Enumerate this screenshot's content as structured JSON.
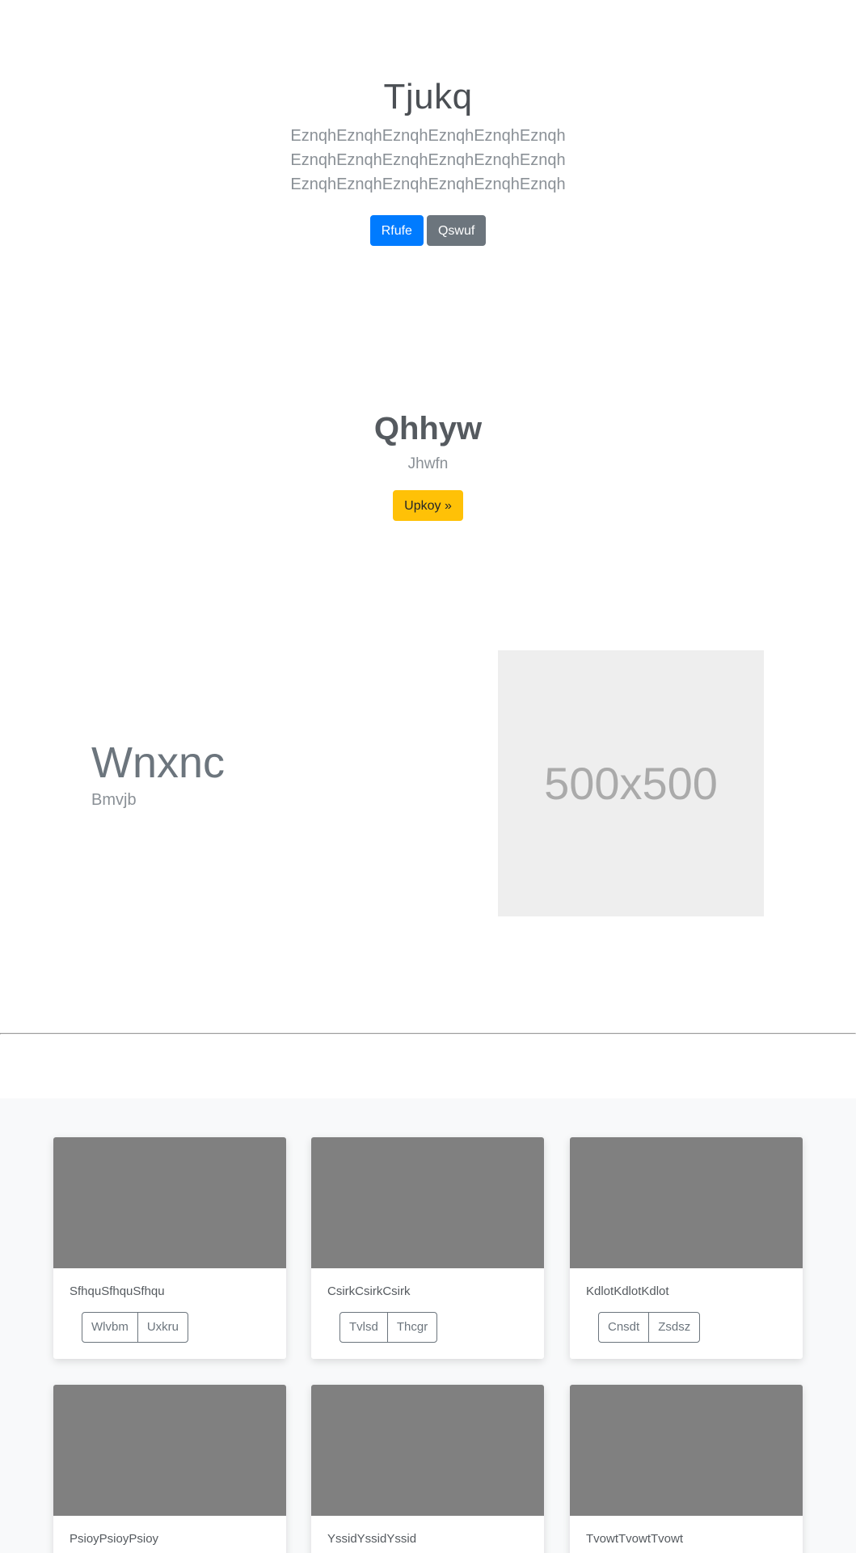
{
  "hero": {
    "title": "Tjukq",
    "lines": [
      "EznqhEznqhEznqhEznqhEznqhEznqh",
      "EznqhEznqhEznqhEznqhEznqhEznqh",
      "EznqhEznqhEznqhEznqhEznqhEznqh"
    ],
    "primary_button": "Rfufe",
    "secondary_button": "Qswuf"
  },
  "cta": {
    "title": "Qhhyw",
    "subtitle": "Jhwfn",
    "button": "Upkoy »"
  },
  "feature": {
    "title": "Wnxnc",
    "subtitle": "Bmvjb",
    "placeholder_text": "500x500"
  },
  "album": {
    "cards": [
      {
        "text": "SfhquSfhquSfhqu",
        "btn1": "Wlvbm",
        "btn2": "Uxkru"
      },
      {
        "text": "CsirkCsirkCsirk",
        "btn1": "Tvlsd",
        "btn2": "Thcgr"
      },
      {
        "text": "KdlotKdlotKdlot",
        "btn1": "Cnsdt",
        "btn2": "Zsdsz"
      },
      {
        "text": "PsioyPsioyPsioy"
      },
      {
        "text": "YssidYssidYssid"
      },
      {
        "text": "TvowtTvowtTvowt"
      }
    ]
  },
  "colors": {
    "primary": "#007bff",
    "secondary": "#6c757d",
    "warning": "#ffc107",
    "card_image": "#808080",
    "placeholder_bg": "#eeeeee"
  }
}
